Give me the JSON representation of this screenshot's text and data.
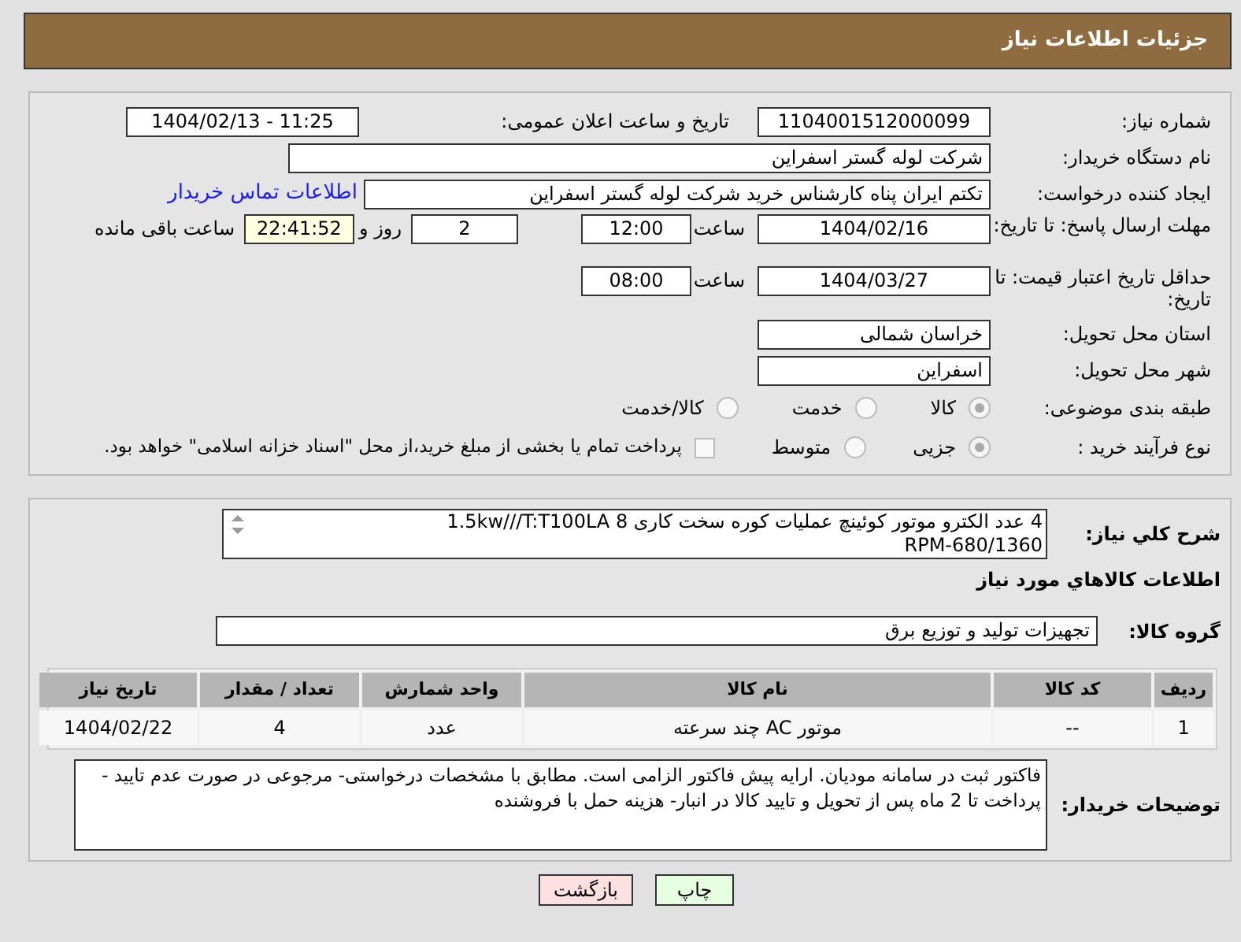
{
  "header": {
    "title": "جزئیات اطلاعات نیاز"
  },
  "need_number": {
    "label": "شماره نیاز:",
    "value": "1104001512000099"
  },
  "announce": {
    "label": "تاریخ و ساعت اعلان عمومی:",
    "value": "1404/02/13 - 11:25"
  },
  "buyer": {
    "label": "نام دستگاه خریدار:",
    "value": "شرکت لوله گستر اسفراین"
  },
  "creator": {
    "label": "ایجاد کننده درخواست:",
    "value": "تکتم ایران پناه کارشناس خرید شرکت لوله گستر اسفراین",
    "link": "اطلاعات تماس خریدار"
  },
  "deadline": {
    "label": "مهلت ارسال پاسخ: تا تاریخ:",
    "date": "1404/02/16",
    "time_label": "ساعت",
    "time": "12:00",
    "days": "2",
    "days_label": "روز و",
    "remaining": "22:41:52",
    "remaining_label": "ساعت باقی مانده"
  },
  "validity": {
    "label": "حداقل تاریخ اعتبار قیمت: تا تاریخ:",
    "date": "1404/03/27",
    "time_label": "ساعت",
    "time": "08:00"
  },
  "province": {
    "label": "استان محل تحویل:",
    "value": "خراسان شمالی"
  },
  "city": {
    "label": "شهر محل تحویل:",
    "value": "اسفراین"
  },
  "category": {
    "label": "طبقه بندی موضوعی:",
    "options": [
      {
        "label": "کالا",
        "selected": true
      },
      {
        "label": "خدمت",
        "selected": false
      },
      {
        "label": "کالا/خدمت",
        "selected": false
      }
    ]
  },
  "process": {
    "label": "نوع فرآیند خرید :",
    "options": [
      {
        "label": "جزیی",
        "selected": true
      },
      {
        "label": "متوسط",
        "selected": false
      }
    ],
    "treasury": {
      "label": "پرداخت تمام یا بخشی از مبلغ خرید،از محل \"اسناد خزانه اسلامی\" خواهد بود.",
      "checked": false
    }
  },
  "description": {
    "label": "شرح کلي نياز:",
    "lines": [
      "4 عدد الکترو موتور کوئینچ عملیات کوره سخت کاری 1.5kw///T:T100LA 8",
      "RPM-680/1360"
    ]
  },
  "goods_title": "اطلاعات کالاهاي مورد نياز",
  "goods_group": {
    "label": "گروه کالا:",
    "value": "تجهیزات تولید و توزیع برق"
  },
  "table": {
    "columns": [
      "ردیف",
      "کد کالا",
      "نام کالا",
      "واحد شمارش",
      "تعداد / مقدار",
      "تاریخ نیاز"
    ],
    "rows": [
      [
        "1",
        "--",
        "موتور AC چند سرعته",
        "عدد",
        "4",
        "1404/02/22"
      ]
    ]
  },
  "buyer_notes": {
    "label": "توضیحات خریدار:",
    "value": "فاکتور ثبت در سامانه مودیان. ارایه پیش فاکتور الزامی است. مطابق با مشخصات درخواستی- مرجوعی در صورت عدم تایید - پرداخت تا 2 ماه پس از تحویل و تایید کالا در انبار- هزینه حمل با فروشنده"
  },
  "buttons": [
    {
      "label": "چاپ",
      "kind": "print"
    },
    {
      "label": "بازگشت",
      "kind": "back"
    }
  ]
}
